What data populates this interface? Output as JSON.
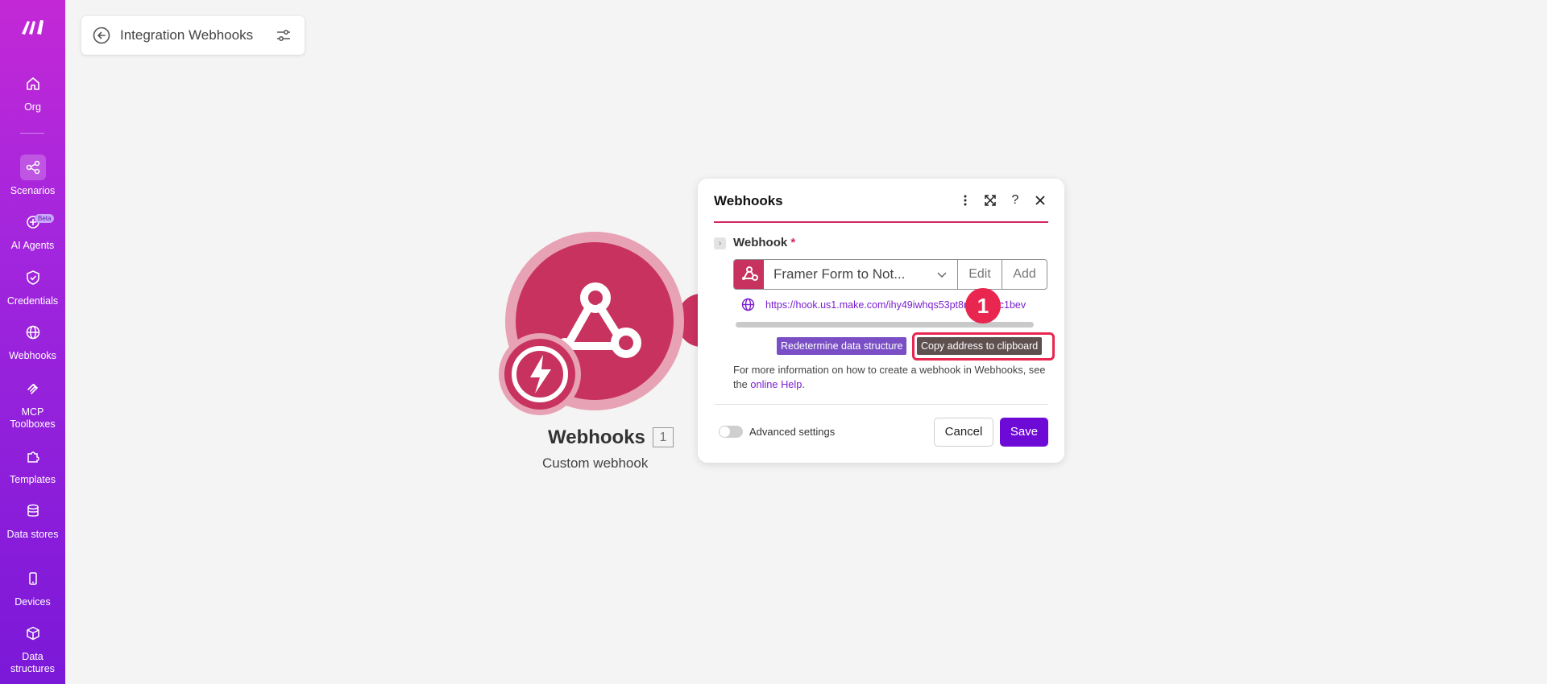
{
  "sidebar": {
    "items": [
      {
        "label": "Org",
        "icon": "home-icon"
      },
      {
        "label": "Scenarios",
        "icon": "share-nodes-icon"
      },
      {
        "label": "AI Agents",
        "icon": "ai-agent-icon",
        "badge": "Beta"
      },
      {
        "label": "Credentials",
        "icon": "shield-check-icon"
      },
      {
        "label": "Webhooks",
        "icon": "globe-icon"
      },
      {
        "label": "MCP Toolboxes",
        "icon": "mcp-icon"
      },
      {
        "label": "Templates",
        "icon": "puzzle-icon"
      },
      {
        "label": "Data stores",
        "icon": "database-icon"
      },
      {
        "label": "Devices",
        "icon": "device-icon"
      },
      {
        "label": "Data structures",
        "icon": "cube-icon"
      }
    ],
    "active": "Scenarios"
  },
  "header": {
    "title": "Integration Webhooks"
  },
  "module": {
    "name": "Webhooks",
    "count": "1",
    "subtitle": "Custom webhook"
  },
  "dialog": {
    "title": "Webhooks",
    "field_label": "Webhook",
    "required_mark": "*",
    "selected_webhook": "Framer Form to Not...",
    "edit_label": "Edit",
    "add_label": "Add",
    "url": "https://hook.us1.make.com/ihy49iwhqs53pt8rk6kk6ac1bev",
    "redetermine_label": "Redetermine data structure",
    "copy_label": "Copy address to clipboard",
    "info_text": "For more information on how to create a webhook in Webhooks, see the ",
    "info_link": "online Help",
    "info_end": ".",
    "advanced_label": "Advanced settings",
    "cancel_label": "Cancel",
    "save_label": "Save"
  },
  "annotation": {
    "step": "1"
  },
  "colors": {
    "brand": "#c8325f",
    "accent": "#6d0ad6",
    "highlight": "#e8264f"
  }
}
